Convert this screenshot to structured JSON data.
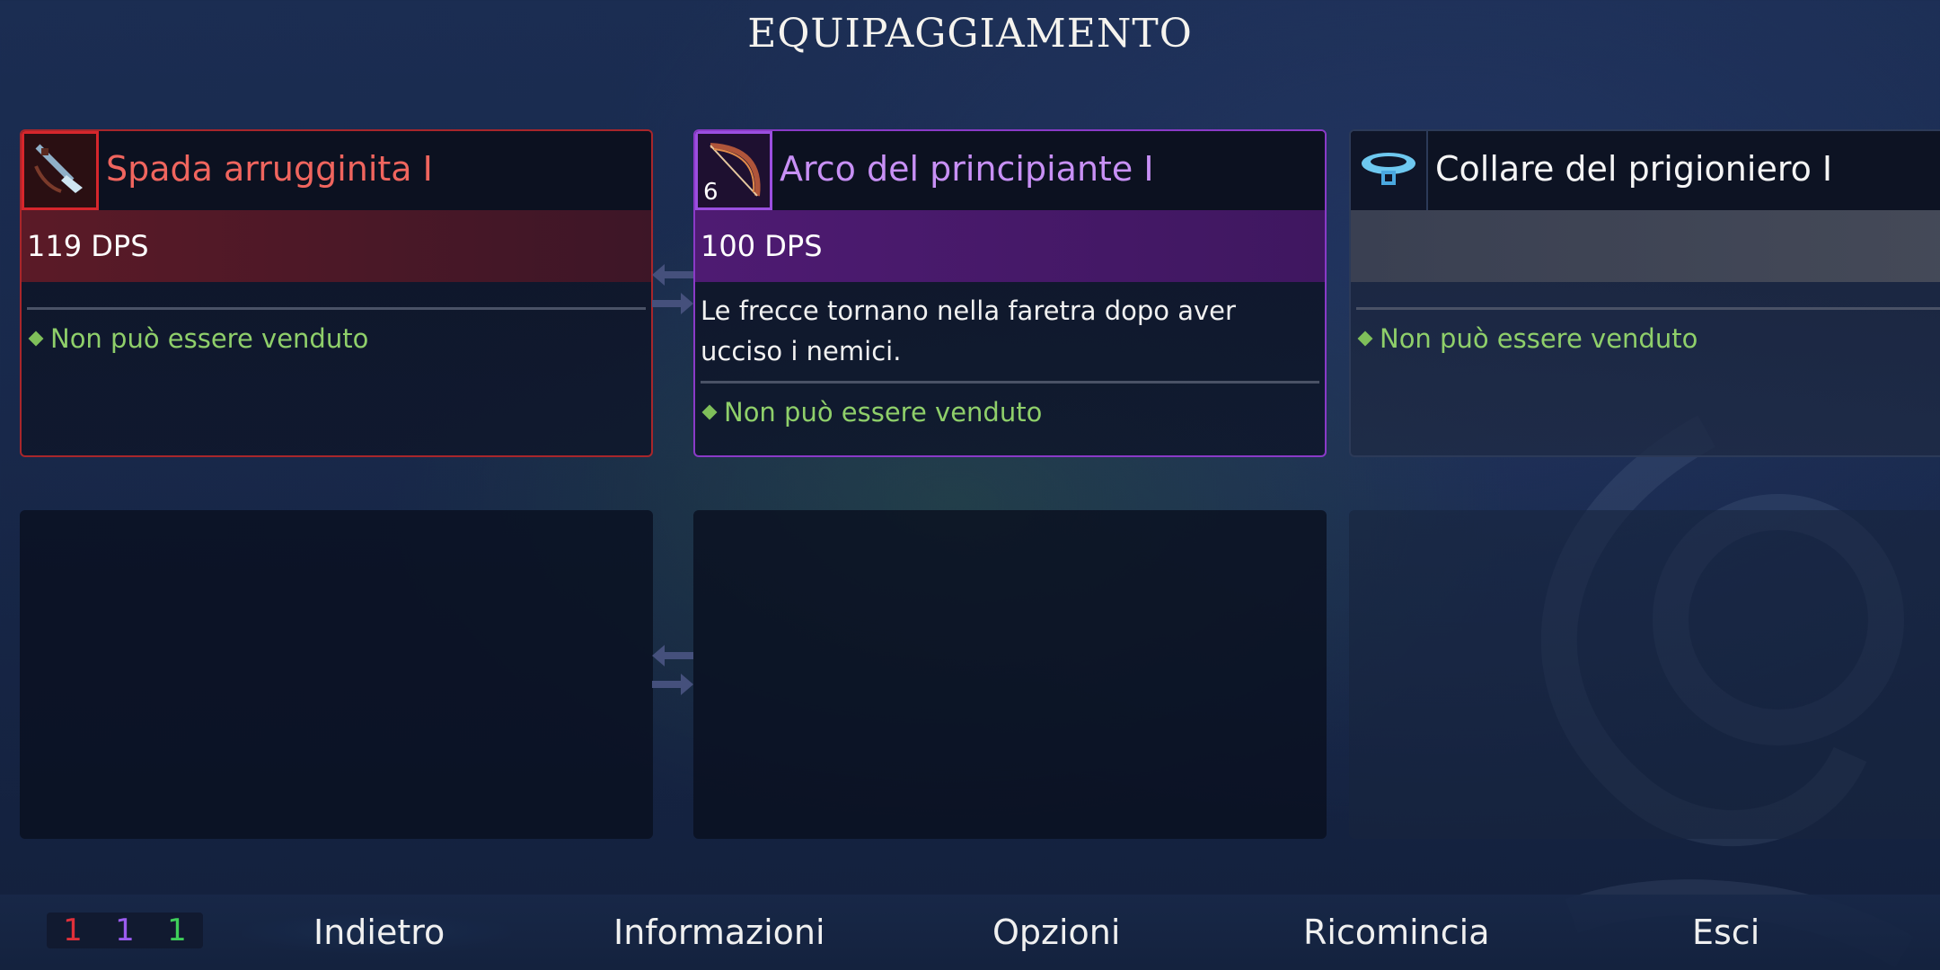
{
  "screen_title": "EQUIPAGGIAMENTO",
  "slots": [
    {
      "name": "Spada arrugginita I",
      "stat": "119 DPS",
      "description": "",
      "note": "Non può essere venduto",
      "rarity_color": "#d6262c",
      "icon": "rusty-sword-icon"
    },
    {
      "name": "Arco del principiante I",
      "stat": "100 DPS",
      "stack_count": "6",
      "description": "Le frecce tornano nella faretra dopo aver ucciso i nemici.",
      "note": "Non può essere venduto",
      "rarity_color": "#9b4fe0",
      "icon": "bow-icon"
    },
    {
      "name": "Collare del prigioniero I",
      "stat": "",
      "description": "",
      "note": "Non può essere venduto",
      "rarity_color": "#2c3a58",
      "icon": "prisoner-collar-icon"
    }
  ],
  "scroll_counters": [
    {
      "value": "1",
      "color": "#e0303a"
    },
    {
      "value": "1",
      "color": "#9b5cf0"
    },
    {
      "value": "1",
      "color": "#3fcf5a"
    }
  ],
  "menu": {
    "back": "Indietro",
    "info": "Informazioni",
    "options": "Opzioni",
    "restart": "Ricomincia",
    "quit": "Esci"
  }
}
